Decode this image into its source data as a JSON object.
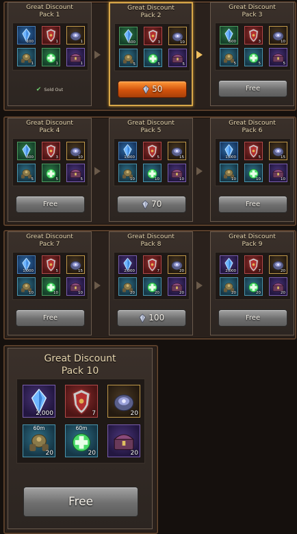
{
  "colors": {
    "accent_gold": "#d8a84a",
    "orange_button": "#d2520c",
    "gray_button": "#7a7a7a"
  },
  "packs": [
    {
      "line1": "Great Discount",
      "line2": "Pack 1",
      "status": "Sold Out",
      "items": [
        "100",
        "1",
        "1",
        "1",
        "1",
        "1"
      ],
      "timers": [
        "",
        "",
        "",
        "",
        "",
        ""
      ]
    },
    {
      "line1": "Great Discount",
      "line2": "Pack 2",
      "button": "50",
      "items": [
        "500",
        "3",
        "10",
        "5",
        "5",
        "5"
      ],
      "timers": [
        "",
        "",
        "",
        "",
        "",
        ""
      ]
    },
    {
      "line1": "Great Discount",
      "line2": "Pack 3",
      "button": "Free",
      "items": [
        "500",
        "3",
        "10",
        "5",
        "5",
        "5"
      ],
      "timers": [
        "",
        "",
        "",
        "",
        "",
        ""
      ]
    },
    {
      "line1": "Great Discount",
      "line2": "Pack 4",
      "button": "Free",
      "items": [
        "500",
        "3",
        "10",
        "5",
        "5",
        "5"
      ],
      "timers": [
        "",
        "",
        "",
        "",
        "",
        ""
      ]
    },
    {
      "line1": "Great Discount",
      "line2": "Pack 5",
      "button": "70",
      "items": [
        "1,000",
        "5",
        "15",
        "10",
        "10",
        "10"
      ],
      "timers": [
        "",
        "",
        "",
        "",
        "",
        ""
      ]
    },
    {
      "line1": "Great Discount",
      "line2": "Pack 6",
      "button": "Free",
      "items": [
        "1,000",
        "5",
        "15",
        "10",
        "10",
        "10"
      ],
      "timers": [
        "",
        "",
        "",
        "",
        "",
        ""
      ]
    },
    {
      "line1": "Great Discount",
      "line2": "Pack 7",
      "button": "Free",
      "items": [
        "1,000",
        "5",
        "15",
        "10",
        "10",
        "10"
      ],
      "timers": [
        "",
        "",
        "",
        "",
        "",
        ""
      ]
    },
    {
      "line1": "Great Discount",
      "line2": "Pack 8",
      "button": "100",
      "items": [
        "2,000",
        "7",
        "20",
        "20",
        "20",
        "20"
      ],
      "timers": [
        "",
        "",
        "",
        "",
        "",
        ""
      ]
    },
    {
      "line1": "Great Discount",
      "line2": "Pack 9",
      "button": "Free",
      "items": [
        "2,000",
        "7",
        "20",
        "20",
        "20",
        "20"
      ],
      "timers": [
        "",
        "",
        "",
        "",
        "",
        ""
      ]
    },
    {
      "line1": "Great Discount",
      "line2": "Pack 10",
      "button": "Free",
      "items": [
        "2,000",
        "7",
        "20",
        "20",
        "20",
        "20"
      ],
      "timers": [
        "",
        "",
        "",
        "60m",
        "60m",
        ""
      ]
    }
  ],
  "item_icons": [
    "crystal-icon",
    "shield-icon",
    "stone-icon",
    "mech-icon",
    "potion-icon",
    "chest-icon"
  ]
}
